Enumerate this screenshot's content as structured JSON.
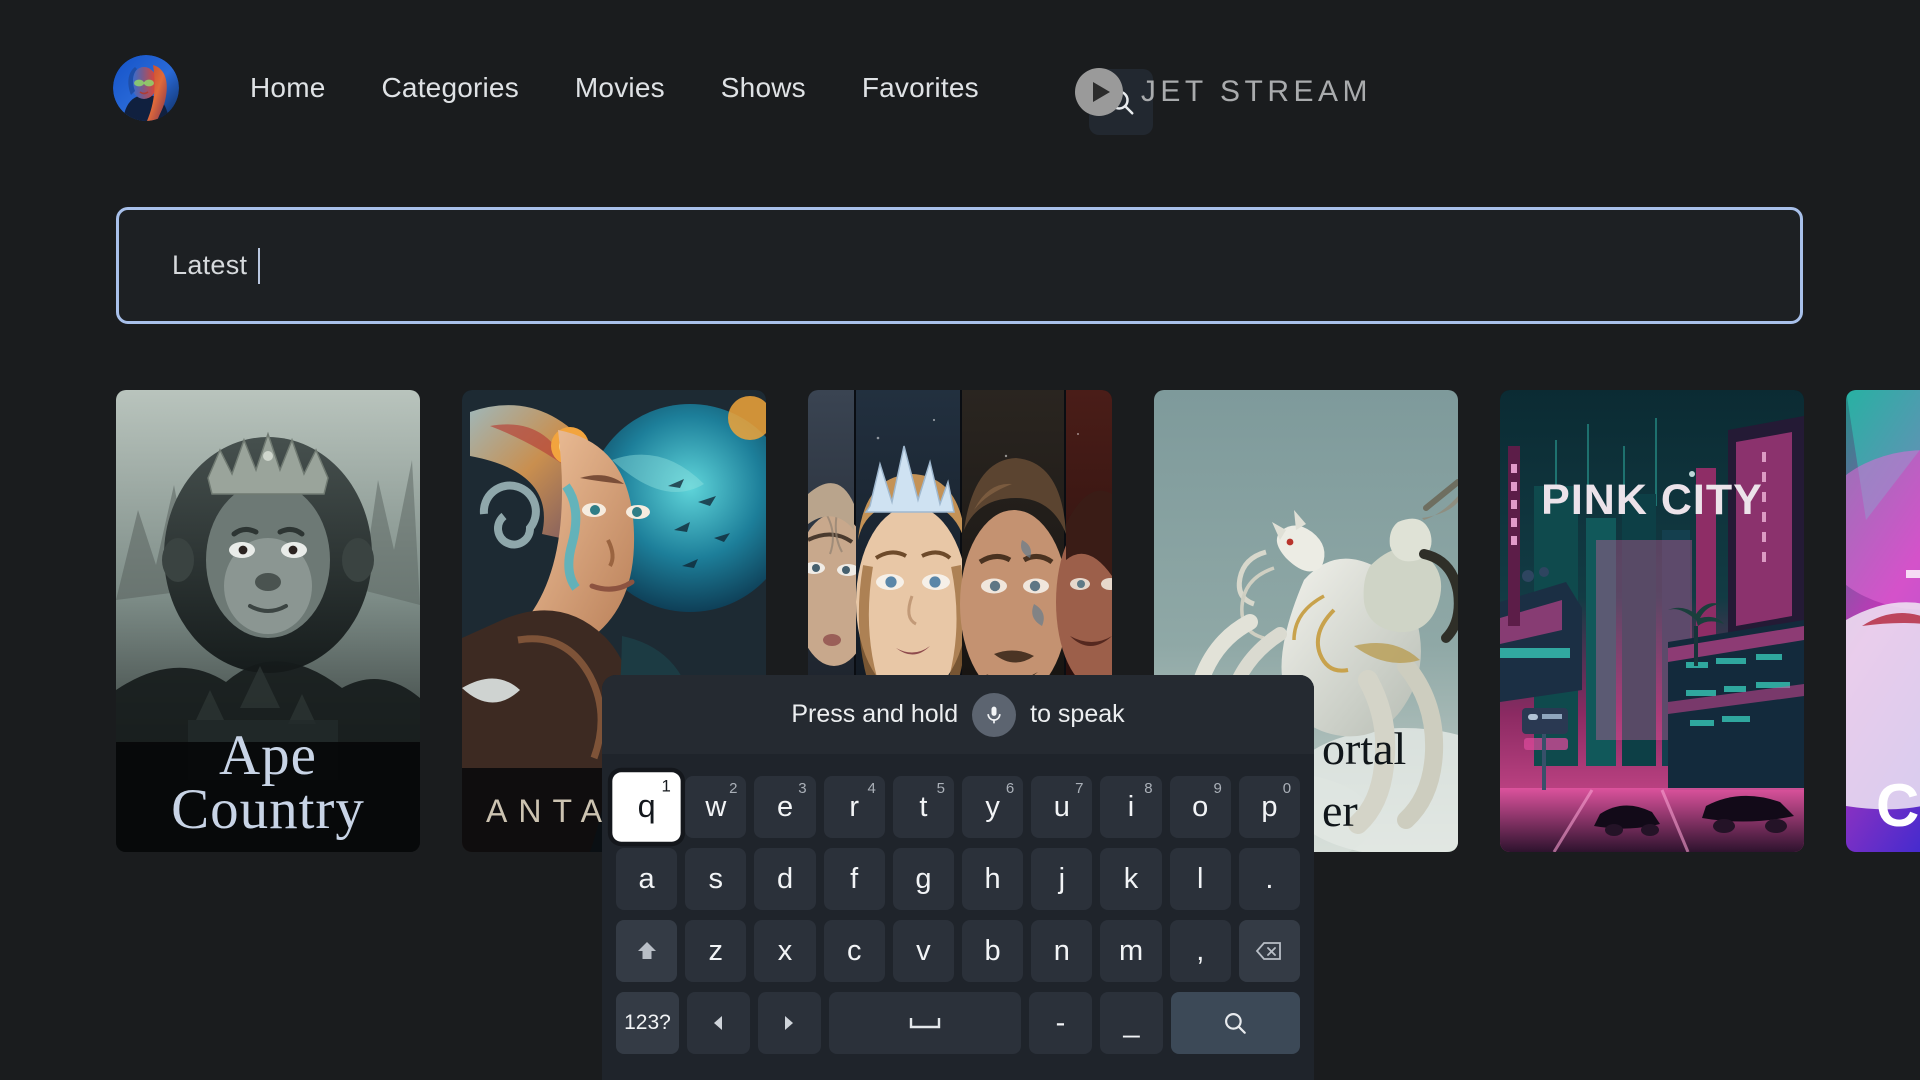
{
  "app": {
    "background_color": "#1a1c1e",
    "accent_color": "#a8c0ea"
  },
  "header": {
    "avatar": {
      "icon": "user-avatar",
      "alt": "profile photo"
    },
    "nav_items": [
      {
        "label": "Home",
        "active": false
      },
      {
        "label": "Categories",
        "active": false
      },
      {
        "label": "Movies",
        "active": false
      },
      {
        "label": "Shows",
        "active": false
      },
      {
        "label": "Favorites",
        "active": false
      }
    ],
    "search_button": {
      "icon": "search-icon"
    },
    "brand": {
      "icon": "play-circle-icon",
      "text": "JET STREAM"
    }
  },
  "search": {
    "value": "Latest",
    "placeholder": "",
    "focused": true,
    "border_color": "#a8c0ea"
  },
  "rail": {
    "items": [
      {
        "title": "Ape Country",
        "title_line_1": "Ape",
        "title_line_2": "Country",
        "art": "crowned-ape-ruins"
      },
      {
        "title": "ANTARES",
        "title_visible": "ANTA",
        "art": "sci-fi-woman-headdress"
      },
      {
        "title": "",
        "title_visible": "",
        "art": "fantasy-ensemble-faces"
      },
      {
        "title": "Immortal Rider",
        "title_line_1": "ortal",
        "title_line_2": "er",
        "art": "white-horse-rider"
      },
      {
        "title": "PINK CITY",
        "title_visible": "PINK CITY",
        "art": "cyberpunk-city"
      },
      {
        "title": "CYBER",
        "title_visible": "CY",
        "art": "neon-portrait"
      }
    ]
  },
  "keyboard": {
    "speak_prompt_before": "Press and hold",
    "speak_prompt_after": "to speak",
    "mic_icon": "microphone-icon",
    "rows": [
      {
        "name": "row-1",
        "keys": [
          {
            "label": "q",
            "sup": "1",
            "focused": true
          },
          {
            "label": "w",
            "sup": "2",
            "focused": false
          },
          {
            "label": "e",
            "sup": "3",
            "focused": false
          },
          {
            "label": "r",
            "sup": "4",
            "focused": false
          },
          {
            "label": "t",
            "sup": "5",
            "focused": false
          },
          {
            "label": "y",
            "sup": "6",
            "focused": false
          },
          {
            "label": "u",
            "sup": "7",
            "focused": false
          },
          {
            "label": "i",
            "sup": "8",
            "focused": false
          },
          {
            "label": "o",
            "sup": "9",
            "focused": false
          },
          {
            "label": "p",
            "sup": "0",
            "focused": false
          }
        ]
      },
      {
        "name": "row-2",
        "keys": [
          {
            "label": "a",
            "sup": "",
            "focused": false
          },
          {
            "label": "s",
            "sup": "",
            "focused": false
          },
          {
            "label": "d",
            "sup": "",
            "focused": false
          },
          {
            "label": "f",
            "sup": "",
            "focused": false
          },
          {
            "label": "g",
            "sup": "",
            "focused": false
          },
          {
            "label": "h",
            "sup": "",
            "focused": false
          },
          {
            "label": "j",
            "sup": "",
            "focused": false
          },
          {
            "label": "k",
            "sup": "",
            "focused": false
          },
          {
            "label": "l",
            "sup": "",
            "focused": false
          },
          {
            "label": ".",
            "sup": "",
            "focused": false
          }
        ]
      },
      {
        "name": "row-3",
        "keys": [
          {
            "label": "",
            "icon": "shift-icon",
            "sup": "",
            "focused": false
          },
          {
            "label": "z",
            "sup": "",
            "focused": false
          },
          {
            "label": "x",
            "sup": "",
            "focused": false
          },
          {
            "label": "c",
            "sup": "",
            "focused": false
          },
          {
            "label": "v",
            "sup": "",
            "focused": false
          },
          {
            "label": "b",
            "sup": "",
            "focused": false
          },
          {
            "label": "n",
            "sup": "",
            "focused": false
          },
          {
            "label": "m",
            "sup": "",
            "focused": false
          },
          {
            "label": ",",
            "sup": "",
            "focused": false
          },
          {
            "label": "",
            "icon": "backspace-icon",
            "sup": "",
            "focused": false
          }
        ]
      },
      {
        "name": "row-4",
        "keys": [
          {
            "label": "123?",
            "sup": "",
            "focused": false
          },
          {
            "label": "",
            "icon": "arrow-left-icon",
            "sup": "",
            "focused": false
          },
          {
            "label": "",
            "icon": "arrow-right-icon",
            "sup": "",
            "focused": false
          },
          {
            "label": "",
            "icon": "space-icon",
            "sup": "",
            "focused": false
          },
          {
            "label": "-",
            "sup": "",
            "focused": false
          },
          {
            "label": "_",
            "sup": "",
            "focused": false
          },
          {
            "label": "",
            "icon": "search-icon",
            "sup": "",
            "focused": false
          }
        ]
      }
    ]
  }
}
